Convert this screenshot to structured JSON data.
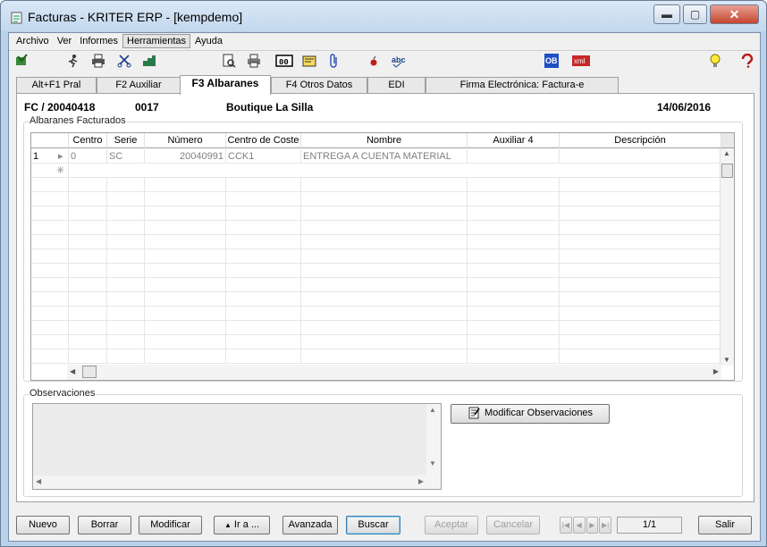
{
  "window": {
    "title": "Facturas - KRITER ERP - [kempdemo]",
    "min": "▬",
    "max": "▢",
    "close": "✕"
  },
  "menu": [
    "Archivo",
    "Ver",
    "Informes",
    "Herramientas",
    "Ayuda"
  ],
  "tabs": [
    "Alt+F1 Pral",
    "F2 Auxiliar",
    "F3 Albaranes",
    "F4 Otros Datos",
    "EDI",
    "Firma Electrónica: Factura-e"
  ],
  "header": {
    "doc": "FC / 20040418",
    "code": "0017",
    "customer": "Boutique La Silla",
    "date": "14/06/2016"
  },
  "albaranes": {
    "label": "Albaranes Facturados",
    "columns": [
      "Centro",
      "Serie",
      "Número",
      "Centro de Coste",
      "Nombre",
      "Auxiliar 4",
      "Descripción"
    ],
    "rows": [
      {
        "num": "1",
        "centro": "0",
        "serie": "SC",
        "numero": "20040991",
        "coste": "CCK1",
        "nombre": "ENTREGA A CUENTA MATERIAL",
        "aux4": "",
        "desc": ""
      }
    ]
  },
  "observaciones": {
    "label": "Observaciones",
    "value": "",
    "button": "Modificar Observaciones"
  },
  "footer": {
    "nuevo": "Nuevo",
    "borrar": "Borrar",
    "modificar": "Modificar",
    "ira": "Ir a ...",
    "avanzada": "Avanzada",
    "buscar": "Buscar",
    "aceptar": "Aceptar",
    "cancelar": "Cancelar",
    "page": "1/1",
    "salir": "Salir"
  },
  "icons": [
    "book-check-icon",
    "run-icon",
    "print-icon",
    "scissors-icon",
    "stack-icon",
    "preview-icon",
    "printer-icon",
    "counter-icon",
    "note-icon",
    "paperclip-icon",
    "red-dot-icon",
    "spellcheck-icon",
    "ob-icon",
    "xml-icon",
    "lightbulb-icon",
    "help-icon"
  ],
  "colors": {
    "accent": "#3c7fb1",
    "frame": "#b9d1ea"
  }
}
